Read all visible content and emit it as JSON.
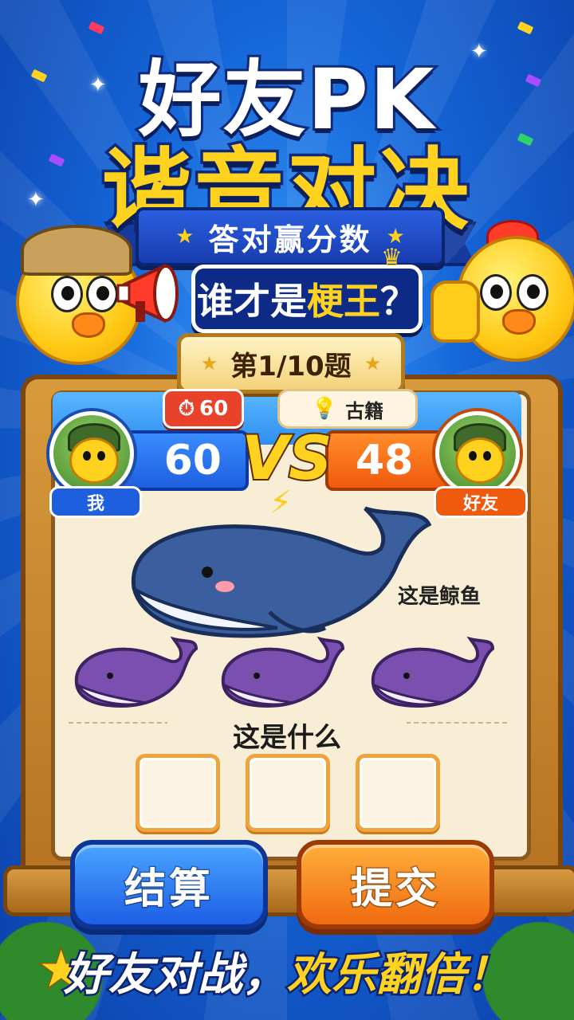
{
  "title": {
    "line1": "好友PK",
    "line2": "谐音对决"
  },
  "ribbon": {
    "text": "答对赢分数"
  },
  "subtitle": {
    "part1": "谁才是",
    "part2": "梗王",
    "part3": "？"
  },
  "question_counter": "第1/10题",
  "timer": {
    "icon": "stopwatch-icon",
    "value": "60"
  },
  "hint": {
    "icon": "lightbulb-icon",
    "text": "古籍"
  },
  "players": {
    "me": {
      "label": "我",
      "score": "60"
    },
    "friend": {
      "label": "好友",
      "score": "48"
    }
  },
  "vs_label": "VS",
  "puzzle": {
    "example_caption": "这是鲸鱼",
    "question": "这是什么",
    "answer_slots": [
      "",
      "",
      ""
    ]
  },
  "buttons": {
    "settle": "结算",
    "submit": "提交"
  },
  "slogan": {
    "part1": "好友对战，",
    "part2": "欢乐翻倍！"
  },
  "colors": {
    "primary_blue": "#1e5fe0",
    "accent_orange": "#f05a0e",
    "title_yellow": "#ffd21f",
    "board_wood": "#b57222"
  }
}
